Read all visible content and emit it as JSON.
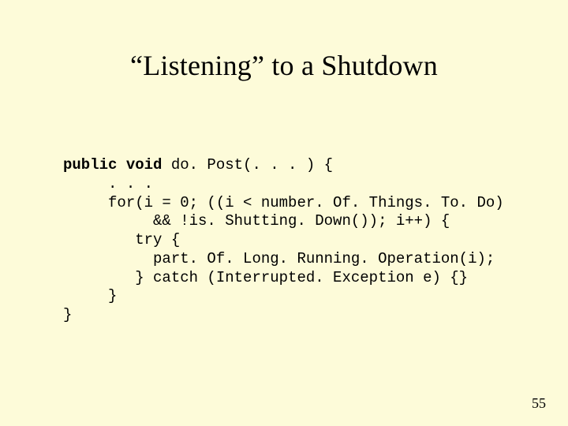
{
  "title": "“Listening” to a Shutdown",
  "code": {
    "line1_pre": "public void",
    "line1_post": " do. Post(. . . ) {",
    "line2": "     . . .",
    "line3": "     for(i = 0; ((i < number. Of. Things. To. Do)",
    "line4": "          && !is. Shutting. Down()); i++) {",
    "line5": "        try {",
    "line6": "          part. Of. Long. Running. Operation(i);",
    "line7": "        } catch (Interrupted. Exception e) {}",
    "line8": "     }",
    "line9": "}"
  },
  "page_number": "55"
}
